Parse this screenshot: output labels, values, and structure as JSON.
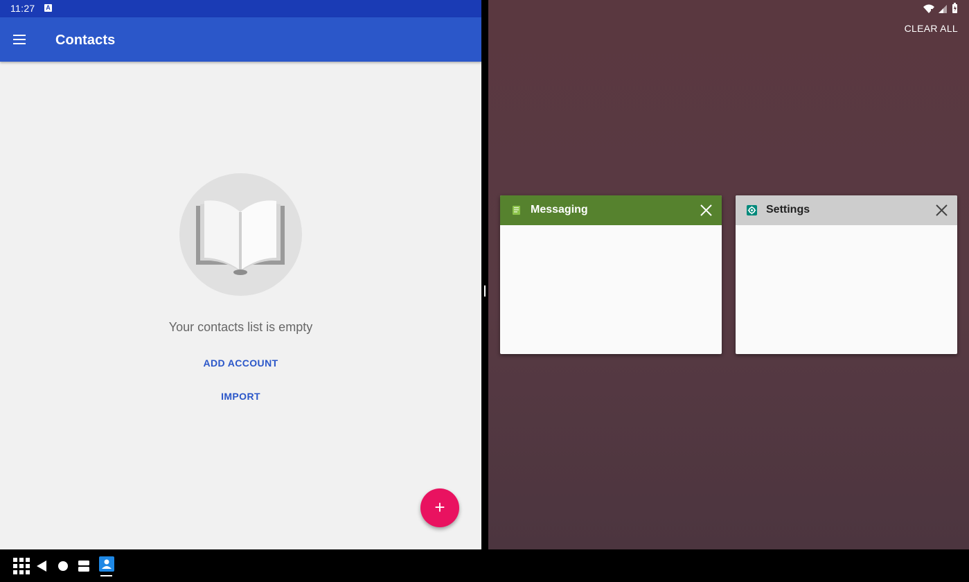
{
  "status_bar": {
    "time": "11:27",
    "notification_icon_letter": "A"
  },
  "contacts_app": {
    "title": "Contacts",
    "empty_message": "Your contacts list is empty",
    "add_account_label": "ADD ACCOUNT",
    "import_label": "IMPORT",
    "fab_symbol": "+"
  },
  "recents": {
    "clear_all_label": "CLEAR ALL",
    "cards": [
      {
        "title": "Messaging",
        "header_color": "#56822e",
        "icon": "messaging-icon"
      },
      {
        "title": "Settings",
        "header_color": "#cdcdcd",
        "icon": "settings-icon"
      }
    ]
  },
  "taskbar": {
    "buttons": [
      "app-drawer-icon",
      "back-icon",
      "home-icon",
      "overview-icon"
    ],
    "pinned_app": "contacts-icon"
  },
  "colors": {
    "status_bar": "#1a3bb5",
    "app_bar": "#2b57c9",
    "fab": "#e91260",
    "link": "#2b57c9",
    "wallpaper": "#5a3840"
  }
}
